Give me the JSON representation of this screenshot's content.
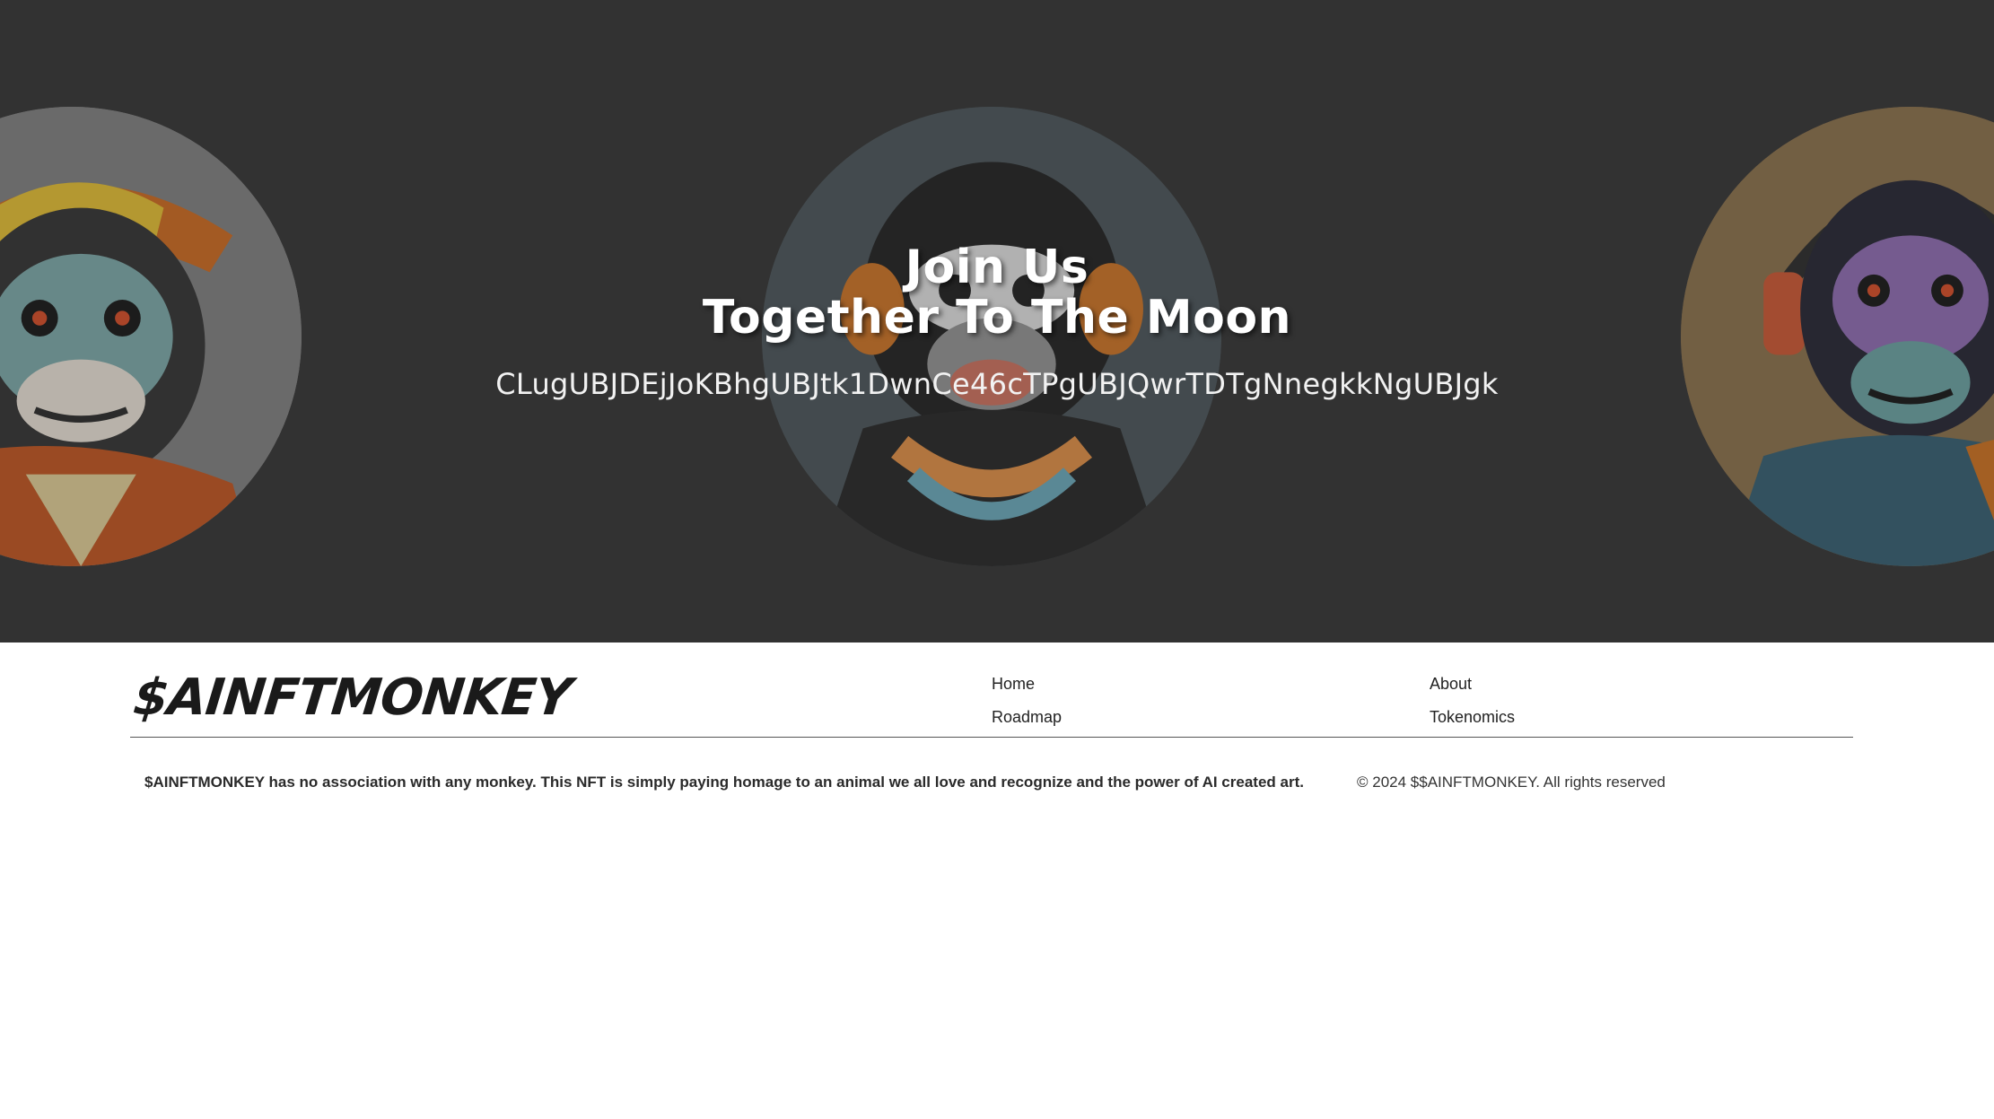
{
  "hero": {
    "title_line1": "Join Us",
    "title_line2": "Together To The Moon",
    "contract_address": "CLugUBJDEjJoKBhgUBJtk1DwnCe46cTPgUBJQwrTDTgNnegkkNgUBJgk",
    "background_color": "#3b3b3b"
  },
  "footer": {
    "logo": "$AINFTMONKEY",
    "nav": {
      "home": "Home",
      "roadmap": "Roadmap",
      "about": "About",
      "tokenomics": "Tokenomics"
    },
    "disclaimer": "$AINFTMONKEY has no association with any monkey. This NFT is simply paying homage to an animal we all love and recognize and the power of AI created art.",
    "copyright": "© 2024 $$AINFTMONKEY. All rights reserved"
  },
  "icons": {
    "monkey_left": "monkey-with-cap-icon",
    "monkey_center": "monkey-with-headphones-icon",
    "monkey_right": "monkey-with-headset-icon"
  }
}
